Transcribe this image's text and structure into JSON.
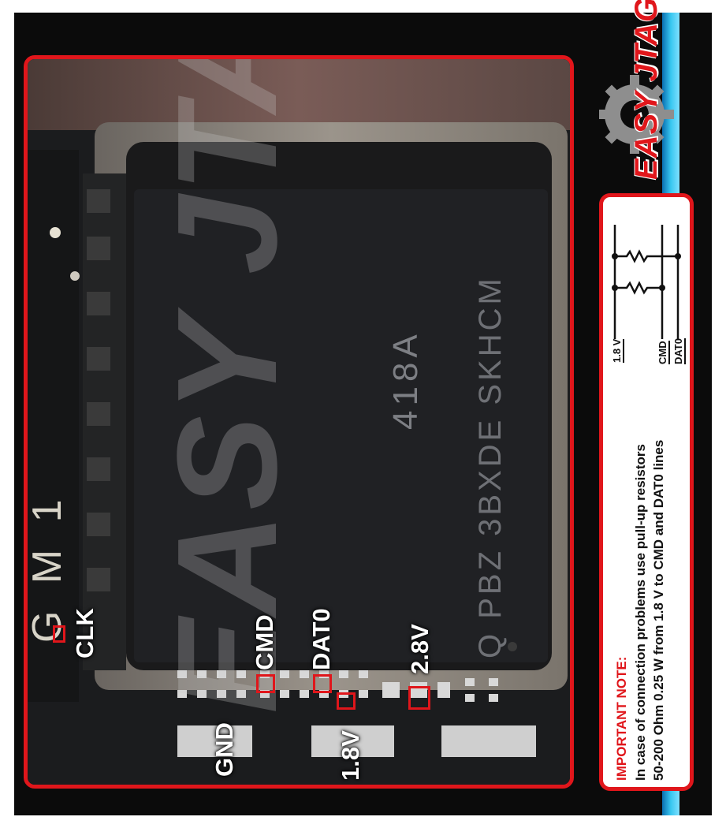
{
  "pins": {
    "clk": "CLK",
    "cmd": "CMD",
    "dat0": "DAT0",
    "v28": "2.8V",
    "gnd": "GND",
    "v18": "1.8V"
  },
  "chip_marking": {
    "line1": "418A",
    "line2": "Q PBZ 3BXDE SKHCM"
  },
  "board_marking": "G M 1",
  "watermark": "EASY JTAG",
  "logo_text": "EASY JTAG",
  "note": {
    "title": "IMPORTANT NOTE:",
    "line1": "In case of connection problems use pull-up resistors",
    "line2": "50-200 Ohm 0.25 W from 1.8 V to CMD and DAT0 lines"
  },
  "schematic": {
    "supply": "1.8 V",
    "cmd": "CMD",
    "dat0": "DAT0"
  },
  "colors": {
    "accent": "#e0161b",
    "stripe": "#38c7f0",
    "note_title": "#e0161b"
  }
}
